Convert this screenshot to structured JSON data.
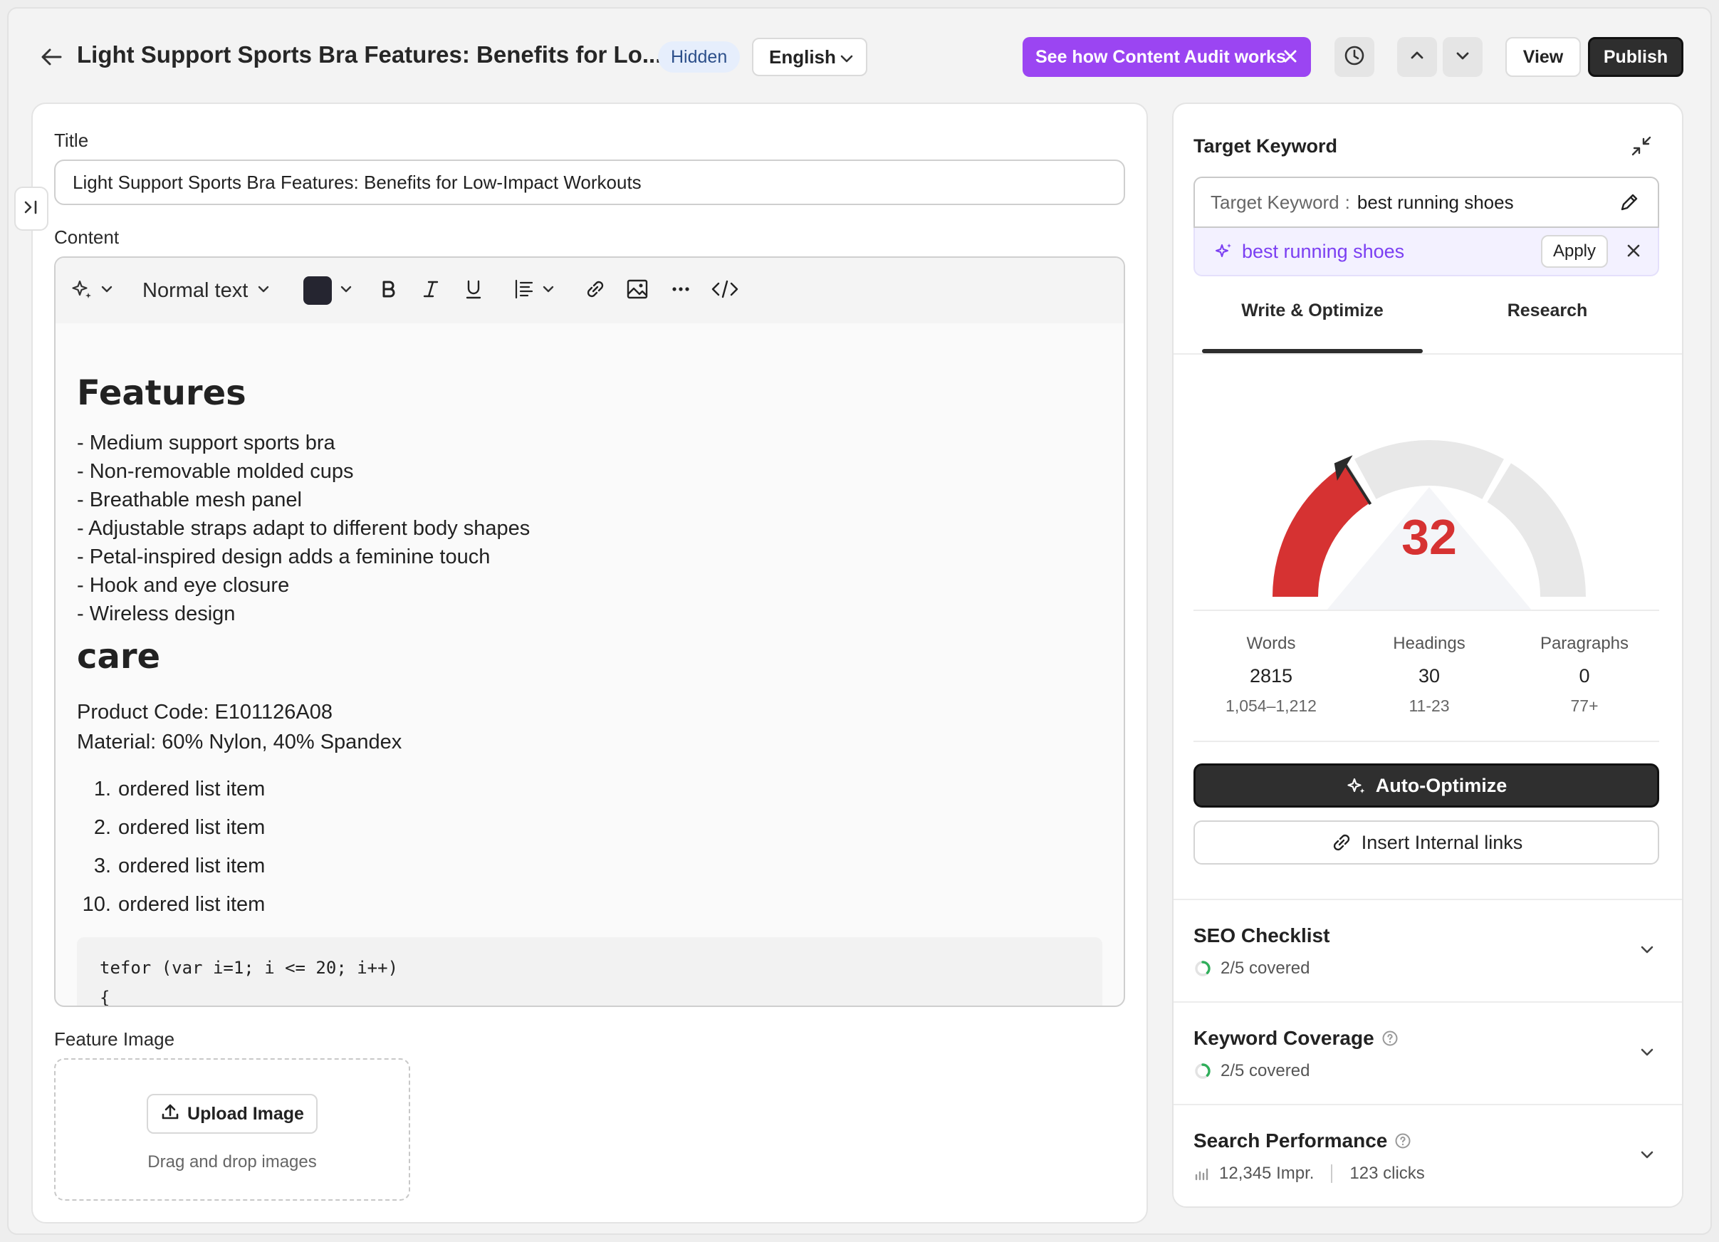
{
  "header": {
    "title": "Light Support Sports Bra Features: Benefits for Lo...",
    "status_badge": "Hidden",
    "language": "English",
    "promo_label": "See how Content Audit works",
    "view_label": "View",
    "publish_label": "Publish"
  },
  "editor": {
    "title_label": "Title",
    "title_value": "Light Support Sports Bra Features: Benefits for Low-Impact Workouts",
    "content_label": "Content",
    "text_style": "Normal text",
    "heading_features": "Features",
    "features": [
      "- Medium support sports bra",
      "- Non-removable molded cups",
      "- Breathable mesh panel",
      "- Adjustable straps adapt to different body shapes",
      "- Petal-inspired design adds a feminine touch",
      "- Hook and eye closure",
      "- Wireless design"
    ],
    "heading_care": "care",
    "product_code": "Product Code: E101126A08",
    "material": "Material: 60% Nylon, 40% Spandex",
    "ordered_list": [
      {
        "num": "1.",
        "text": "ordered list item"
      },
      {
        "num": "2.",
        "text": "ordered list item"
      },
      {
        "num": "3.",
        "text": "ordered list item"
      },
      {
        "num": "10.",
        "text": "ordered list item"
      }
    ],
    "code_line1": "tefor (var i=1; i <= 20; i++)",
    "code_line2": "{",
    "feature_image_label": "Feature Image",
    "upload_label": "Upload Image",
    "drag_text": "Drag and drop images"
  },
  "sidebar": {
    "target_keyword_heading": "Target Keyword",
    "keyword_field_label": "Target Keyword",
    "keyword_value": "best running shoes",
    "suggested_keyword": "best running shoes",
    "apply_label": "Apply",
    "tabs": [
      "Write & Optimize",
      "Research"
    ],
    "score": "32",
    "score_fraction": 0.32,
    "stats": [
      {
        "label": "Words",
        "value": "2815",
        "range": "1,054–1,212"
      },
      {
        "label": "Headings",
        "value": "30",
        "range": "11-23"
      },
      {
        "label": "Paragraphs",
        "value": "0",
        "range": "77+"
      }
    ],
    "auto_optimize_label": "Auto-Optimize",
    "insert_links_label": "Insert Internal links",
    "seo_checklist": {
      "title": "SEO Checklist",
      "sub": "2/5 covered"
    },
    "keyword_coverage": {
      "title": "Keyword Coverage",
      "sub": "2/5 covered"
    },
    "search_performance": {
      "title": "Search Performance",
      "impressions": "12,345 Impr.",
      "clicks": "123 clicks"
    }
  },
  "colors": {
    "accent_purple": "#9b45f2",
    "score_red": "#d63232",
    "progress_green": "#2fae5a"
  }
}
